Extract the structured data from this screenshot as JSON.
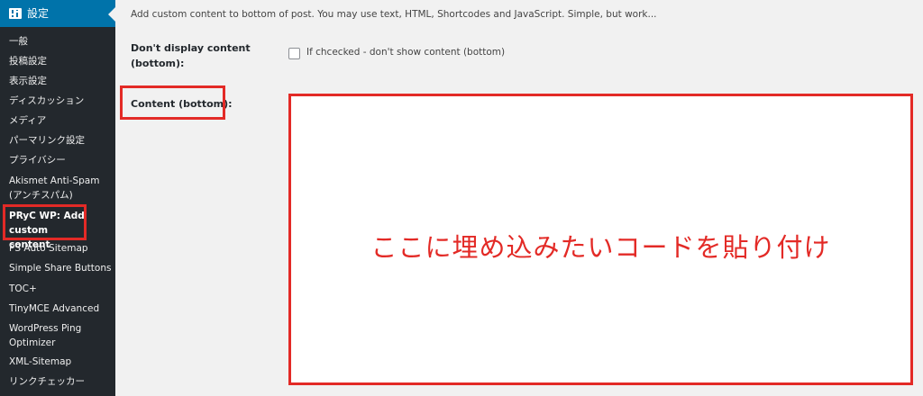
{
  "sidebar": {
    "settings_label": "設定",
    "items": [
      {
        "label": "一般"
      },
      {
        "label": "投稿設定"
      },
      {
        "label": "表示設定"
      },
      {
        "label": "ディスカッション"
      },
      {
        "label": "メディア"
      },
      {
        "label": "パーマリンク設定"
      },
      {
        "label": "プライバシー"
      },
      {
        "label": "Akismet Anti-Spam (アンチスパム)"
      },
      {
        "label": "PRyC WP: Add custom content"
      },
      {
        "label": "PS Auto Sitemap"
      },
      {
        "label": "Simple Share Buttons"
      },
      {
        "label": "TOC+"
      },
      {
        "label": "TinyMCE Advanced"
      },
      {
        "label": "WordPress Ping Optimizer"
      },
      {
        "label": "XML-Sitemap"
      },
      {
        "label": "リンクチェッカー"
      }
    ]
  },
  "main": {
    "description": "Add custom content to bottom of post. You may use text, HTML, Shortcodes and JavaScript. Simple, but work...",
    "display_label": "Don't display content (bottom):",
    "checkbox_label": "If chcecked - don't show content (bottom)",
    "checkbox_checked": false,
    "content_label": "Content (bottom):",
    "annotation_text": "ここに埋め込みたいコードを貼り付け"
  },
  "colors": {
    "sidebar_bg": "#23282d",
    "accent": "#0073aa",
    "highlight": "#e32a26"
  }
}
